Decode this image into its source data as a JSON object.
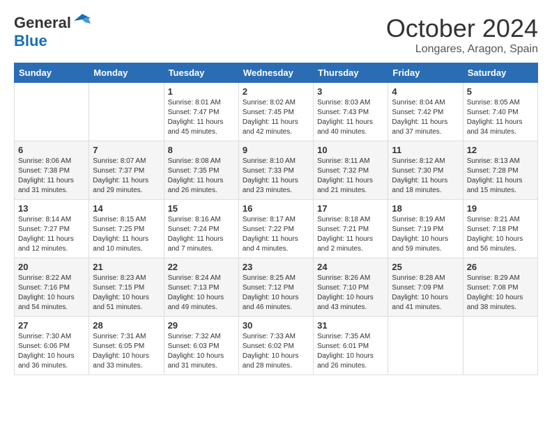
{
  "header": {
    "logo_general": "General",
    "logo_blue": "Blue",
    "month_title": "October 2024",
    "location": "Longares, Aragon, Spain"
  },
  "weekdays": [
    "Sunday",
    "Monday",
    "Tuesday",
    "Wednesday",
    "Thursday",
    "Friday",
    "Saturday"
  ],
  "weeks": [
    [
      {
        "day": "",
        "content": ""
      },
      {
        "day": "",
        "content": ""
      },
      {
        "day": "1",
        "content": "Sunrise: 8:01 AM\nSunset: 7:47 PM\nDaylight: 11 hours and 45 minutes."
      },
      {
        "day": "2",
        "content": "Sunrise: 8:02 AM\nSunset: 7:45 PM\nDaylight: 11 hours and 42 minutes."
      },
      {
        "day": "3",
        "content": "Sunrise: 8:03 AM\nSunset: 7:43 PM\nDaylight: 11 hours and 40 minutes."
      },
      {
        "day": "4",
        "content": "Sunrise: 8:04 AM\nSunset: 7:42 PM\nDaylight: 11 hours and 37 minutes."
      },
      {
        "day": "5",
        "content": "Sunrise: 8:05 AM\nSunset: 7:40 PM\nDaylight: 11 hours and 34 minutes."
      }
    ],
    [
      {
        "day": "6",
        "content": "Sunrise: 8:06 AM\nSunset: 7:38 PM\nDaylight: 11 hours and 31 minutes."
      },
      {
        "day": "7",
        "content": "Sunrise: 8:07 AM\nSunset: 7:37 PM\nDaylight: 11 hours and 29 minutes."
      },
      {
        "day": "8",
        "content": "Sunrise: 8:08 AM\nSunset: 7:35 PM\nDaylight: 11 hours and 26 minutes."
      },
      {
        "day": "9",
        "content": "Sunrise: 8:10 AM\nSunset: 7:33 PM\nDaylight: 11 hours and 23 minutes."
      },
      {
        "day": "10",
        "content": "Sunrise: 8:11 AM\nSunset: 7:32 PM\nDaylight: 11 hours and 21 minutes."
      },
      {
        "day": "11",
        "content": "Sunrise: 8:12 AM\nSunset: 7:30 PM\nDaylight: 11 hours and 18 minutes."
      },
      {
        "day": "12",
        "content": "Sunrise: 8:13 AM\nSunset: 7:28 PM\nDaylight: 11 hours and 15 minutes."
      }
    ],
    [
      {
        "day": "13",
        "content": "Sunrise: 8:14 AM\nSunset: 7:27 PM\nDaylight: 11 hours and 12 minutes."
      },
      {
        "day": "14",
        "content": "Sunrise: 8:15 AM\nSunset: 7:25 PM\nDaylight: 11 hours and 10 minutes."
      },
      {
        "day": "15",
        "content": "Sunrise: 8:16 AM\nSunset: 7:24 PM\nDaylight: 11 hours and 7 minutes."
      },
      {
        "day": "16",
        "content": "Sunrise: 8:17 AM\nSunset: 7:22 PM\nDaylight: 11 hours and 4 minutes."
      },
      {
        "day": "17",
        "content": "Sunrise: 8:18 AM\nSunset: 7:21 PM\nDaylight: 11 hours and 2 minutes."
      },
      {
        "day": "18",
        "content": "Sunrise: 8:19 AM\nSunset: 7:19 PM\nDaylight: 10 hours and 59 minutes."
      },
      {
        "day": "19",
        "content": "Sunrise: 8:21 AM\nSunset: 7:18 PM\nDaylight: 10 hours and 56 minutes."
      }
    ],
    [
      {
        "day": "20",
        "content": "Sunrise: 8:22 AM\nSunset: 7:16 PM\nDaylight: 10 hours and 54 minutes."
      },
      {
        "day": "21",
        "content": "Sunrise: 8:23 AM\nSunset: 7:15 PM\nDaylight: 10 hours and 51 minutes."
      },
      {
        "day": "22",
        "content": "Sunrise: 8:24 AM\nSunset: 7:13 PM\nDaylight: 10 hours and 49 minutes."
      },
      {
        "day": "23",
        "content": "Sunrise: 8:25 AM\nSunset: 7:12 PM\nDaylight: 10 hours and 46 minutes."
      },
      {
        "day": "24",
        "content": "Sunrise: 8:26 AM\nSunset: 7:10 PM\nDaylight: 10 hours and 43 minutes."
      },
      {
        "day": "25",
        "content": "Sunrise: 8:28 AM\nSunset: 7:09 PM\nDaylight: 10 hours and 41 minutes."
      },
      {
        "day": "26",
        "content": "Sunrise: 8:29 AM\nSunset: 7:08 PM\nDaylight: 10 hours and 38 minutes."
      }
    ],
    [
      {
        "day": "27",
        "content": "Sunrise: 7:30 AM\nSunset: 6:06 PM\nDaylight: 10 hours and 36 minutes."
      },
      {
        "day": "28",
        "content": "Sunrise: 7:31 AM\nSunset: 6:05 PM\nDaylight: 10 hours and 33 minutes."
      },
      {
        "day": "29",
        "content": "Sunrise: 7:32 AM\nSunset: 6:03 PM\nDaylight: 10 hours and 31 minutes."
      },
      {
        "day": "30",
        "content": "Sunrise: 7:33 AM\nSunset: 6:02 PM\nDaylight: 10 hours and 28 minutes."
      },
      {
        "day": "31",
        "content": "Sunrise: 7:35 AM\nSunset: 6:01 PM\nDaylight: 10 hours and 26 minutes."
      },
      {
        "day": "",
        "content": ""
      },
      {
        "day": "",
        "content": ""
      }
    ]
  ]
}
